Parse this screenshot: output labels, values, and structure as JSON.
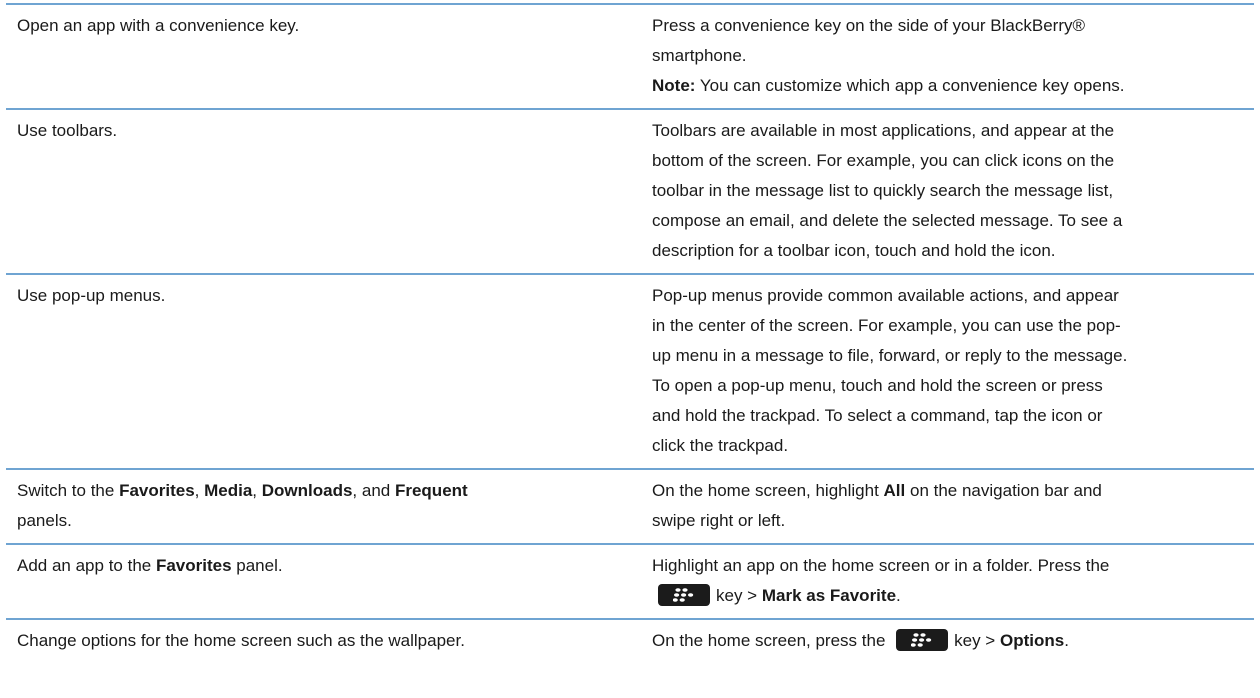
{
  "rows": [
    {
      "task": "Open an app with a convenience key.",
      "desc": {
        "line1": "Press a convenience key on the side of your BlackBerry®",
        "line2": "smartphone.",
        "note_label": "Note:",
        "note_text": " You can customize which app a convenience key opens."
      }
    },
    {
      "task": "Use toolbars.",
      "desc_lines": [
        "Toolbars are available in most applications, and appear at the",
        "bottom of the screen. For example, you can click icons on the",
        "toolbar in the message list to quickly search the message list,",
        "compose an email, and delete the selected message. To see a",
        "description for a toolbar icon, touch and hold the icon."
      ]
    },
    {
      "task": "Use pop-up menus.",
      "desc_lines": [
        "Pop-up menus provide common available actions, and appear",
        "in the center of the screen. For example, you can use the pop-",
        "up menu in a message to file, forward, or reply to the message.",
        "To open a pop-up menu, touch and hold the screen or press",
        "and hold the trackpad. To select a command, tap the icon or",
        "click the trackpad."
      ]
    },
    {
      "task": {
        "t1": "Switch to the ",
        "b1": "Favorites",
        "t2": ", ",
        "b2": "Media",
        "t3": ", ",
        "b3": "Downloads",
        "t4": ", and ",
        "b4": "Frequent",
        "t5": "panels."
      },
      "desc": {
        "t1": "On the home screen, highlight ",
        "b1": "All",
        "t2": " on the navigation bar and",
        "line2": "swipe right or left."
      }
    },
    {
      "task": {
        "t1": "Add an app to the ",
        "b1": "Favorites",
        "t2": " panel."
      },
      "desc": {
        "line1": "Highlight an app on the home screen or in a folder. Press the",
        "t2": "key > ",
        "b2": "Mark as Favorite",
        "t3": "."
      }
    },
    {
      "task": "Change options for the home screen such as the wallpaper.",
      "desc": {
        "t1": "On the home screen, press the ",
        "t2": "key > ",
        "b2": "Options",
        "t3": "."
      }
    }
  ],
  "icons": {
    "menu_key": "blackberry-menu-key-icon"
  },
  "colors": {
    "rule": "#6fa4d2",
    "text": "#1a1a1a"
  }
}
